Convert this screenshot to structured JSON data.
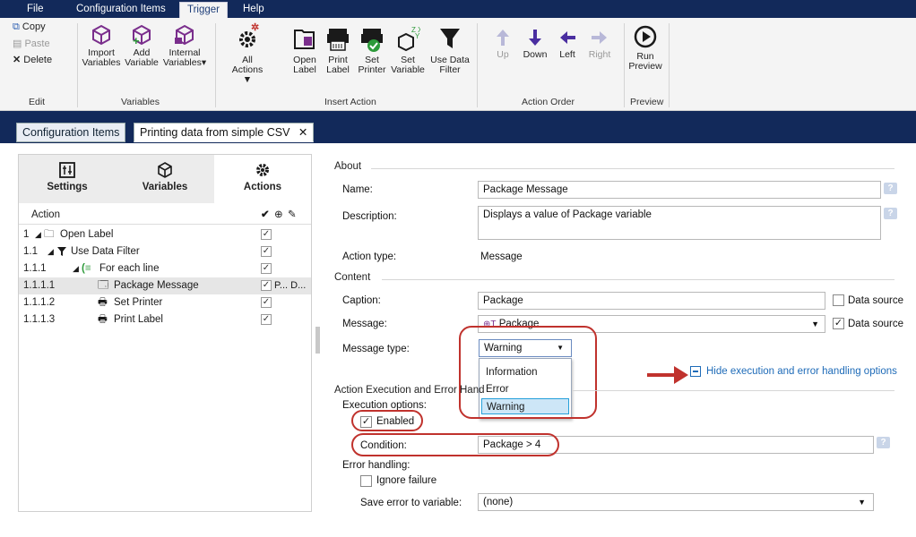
{
  "menu": {
    "tabs": [
      "File",
      "Configuration Items",
      "Trigger",
      "Help"
    ],
    "active_tab": "Trigger"
  },
  "ribbon": {
    "edit": {
      "copy": "Copy",
      "paste": "Paste",
      "delete": "Delete",
      "group": "Edit"
    },
    "variables": {
      "import": [
        "Import",
        "Variables"
      ],
      "add": [
        "Add",
        "Variable"
      ],
      "internal": [
        "Internal",
        "Variables▾"
      ],
      "group": "Variables"
    },
    "insert": {
      "all": [
        "All",
        "Actions ▼"
      ],
      "open": [
        "Open",
        "Label"
      ],
      "print": [
        "Print",
        "Label"
      ],
      "set_printer": [
        "Set",
        "Printer"
      ],
      "set_variable": [
        "Set",
        "Variable"
      ],
      "use_filter": [
        "Use Data",
        "Filter"
      ],
      "group": "Insert Action"
    },
    "order": {
      "up": "Up",
      "down": "Down",
      "left": "Left",
      "right": "Right",
      "group": "Action Order"
    },
    "preview": {
      "run": [
        "Run",
        "Preview"
      ],
      "group": "Preview"
    }
  },
  "doc_tabs": {
    "config": "Configuration Items",
    "printing": "Printing data from simple CSV",
    "close": "✕"
  },
  "left_tabs": {
    "settings": "Settings",
    "variables": "Variables",
    "actions": "Actions"
  },
  "action_table": {
    "header": "Action",
    "rows": [
      {
        "num": "1",
        "label": "Open Label",
        "checked": true,
        "extra": ""
      },
      {
        "num": "1.1",
        "label": "Use Data Filter",
        "checked": true,
        "extra": ""
      },
      {
        "num": "1.1.1",
        "label": "For each line",
        "checked": true,
        "extra": ""
      },
      {
        "num": "1.1.1.1",
        "label": "Package Message",
        "checked": true,
        "extra": "P... D..."
      },
      {
        "num": "1.1.1.2",
        "label": "Set Printer",
        "checked": true,
        "extra": ""
      },
      {
        "num": "1.1.1.3",
        "label": "Print Label",
        "checked": true,
        "extra": ""
      }
    ]
  },
  "form": {
    "about": "About",
    "name_label": "Name:",
    "name_value": "Package Message",
    "desc_label": "Description:",
    "desc_value": "Displays a value of Package variable",
    "type_label": "Action type:",
    "type_value": "Message",
    "content": "Content",
    "caption_label": "Caption:",
    "caption_value": "Package",
    "datasource": "Data source",
    "message_label": "Message:",
    "message_value": "Package",
    "msgtype_label": "Message type:",
    "msgtype_value": "Warning",
    "msgtype_options": [
      "Information",
      "Error",
      "Warning"
    ],
    "hide_link": "Hide execution and error handling options",
    "exec_section": "Action Execution and Error Hand",
    "exec_options": "Execution options:",
    "enabled": "Enabled",
    "condition_label": "Condition:",
    "condition_value": "Package > 4",
    "error_handling": "Error handling:",
    "ignore_failure": "Ignore failure",
    "save_error_label": "Save error to variable:",
    "save_error_value": "(none)"
  },
  "colors": {
    "titlebar": "#12295a",
    "highlight": "#c0322d",
    "link": "#1e6bb8"
  }
}
